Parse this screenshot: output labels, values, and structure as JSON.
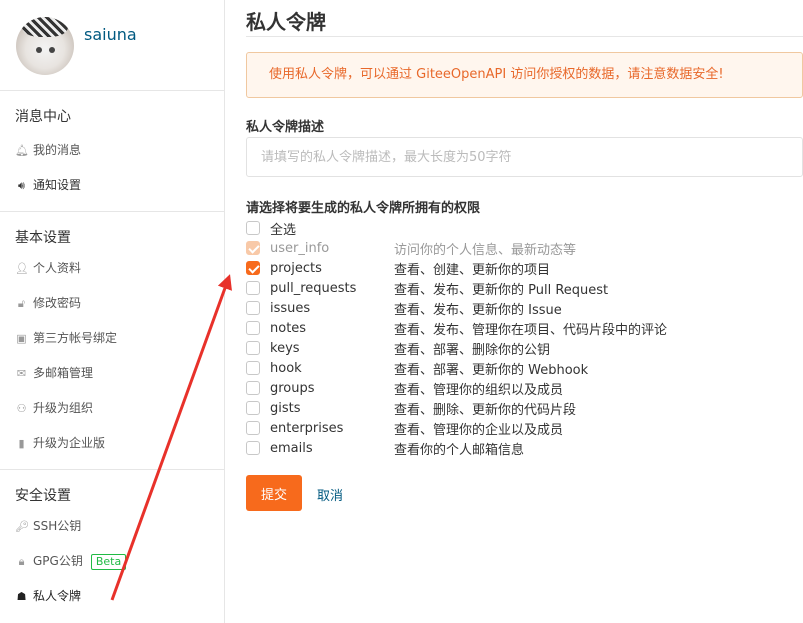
{
  "sidebar": {
    "username": "saiuna",
    "sections": [
      {
        "title": "消息中心",
        "items": [
          {
            "label": "我的消息",
            "icon": "bell-icon"
          },
          {
            "label": "通知设置",
            "icon": "speaker-icon"
          }
        ]
      },
      {
        "title": "基本设置",
        "items": [
          {
            "label": "个人资料",
            "icon": "user-icon"
          },
          {
            "label": "修改密码",
            "icon": "unlock-icon"
          },
          {
            "label": "第三方帐号绑定",
            "icon": "id-card-icon"
          },
          {
            "label": "多邮箱管理",
            "icon": "mail-icon"
          },
          {
            "label": "升级为组织",
            "icon": "group-icon"
          },
          {
            "label": "升级为企业版",
            "icon": "building-icon"
          }
        ]
      },
      {
        "title": "安全设置",
        "items": [
          {
            "label": "SSH公钥",
            "icon": "key-icon"
          },
          {
            "label": "GPG公钥",
            "icon": "lock-icon",
            "badge": "Beta"
          },
          {
            "label": "私人令牌",
            "icon": "sitemap-icon"
          }
        ]
      }
    ]
  },
  "main": {
    "title": "私人令牌",
    "warning": "使用私人令牌，可以通过 GiteeOpenAPI 访问你授权的数据，请注意数据安全!",
    "desc_label": "私人令牌描述",
    "desc_placeholder": "请填写的私人令牌描述，最大长度为50字符",
    "perm_label": "请选择将要生成的私人令牌所拥有的权限",
    "select_all": "全选",
    "permissions": [
      {
        "name": "user_info",
        "desc": "访问你的个人信息、最新动态等",
        "checked": true,
        "disabled": true
      },
      {
        "name": "projects",
        "desc": "查看、创建、更新你的项目",
        "checked": true,
        "disabled": false
      },
      {
        "name": "pull_requests",
        "desc": "查看、发布、更新你的 Pull Request",
        "checked": false,
        "disabled": false
      },
      {
        "name": "issues",
        "desc": "查看、发布、更新你的 Issue",
        "checked": false,
        "disabled": false
      },
      {
        "name": "notes",
        "desc": "查看、发布、管理你在项目、代码片段中的评论",
        "checked": false,
        "disabled": false
      },
      {
        "name": "keys",
        "desc": "查看、部署、删除你的公钥",
        "checked": false,
        "disabled": false
      },
      {
        "name": "hook",
        "desc": "查看、部署、更新你的 Webhook",
        "checked": false,
        "disabled": false
      },
      {
        "name": "groups",
        "desc": "查看、管理你的组织以及成员",
        "checked": false,
        "disabled": false
      },
      {
        "name": "gists",
        "desc": "查看、删除、更新你的代码片段",
        "checked": false,
        "disabled": false
      },
      {
        "name": "enterprises",
        "desc": "查看、管理你的企业以及成员",
        "checked": false,
        "disabled": false
      },
      {
        "name": "emails",
        "desc": "查看你的个人邮箱信息",
        "checked": false,
        "disabled": false
      }
    ],
    "submit_label": "提交",
    "cancel_label": "取消"
  },
  "colors": {
    "accent": "#f76a1c",
    "link": "#005980",
    "arrow": "#e8312a"
  }
}
